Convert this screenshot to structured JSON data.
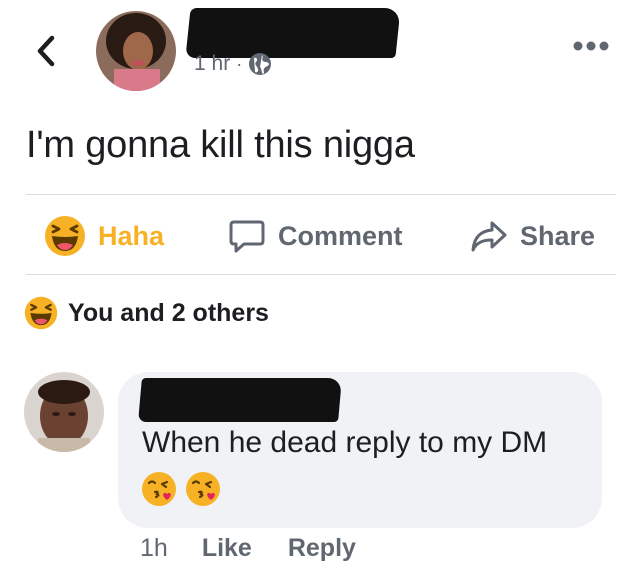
{
  "post": {
    "time": "1 hr",
    "separator": "·",
    "text": "I'm gonna kill this nigga"
  },
  "actions": {
    "haha_label": "Haha",
    "comment_label": "Comment",
    "share_label": "Share"
  },
  "reactions": {
    "summary": "You and 2 others"
  },
  "comment": {
    "text": "When he dead reply to my DM",
    "time": "1h",
    "like_label": "Like",
    "reply_label": "Reply"
  },
  "colors": {
    "haha_active": "#f7b125",
    "secondary_text": "#606770",
    "bubble_bg": "#f0f2f5",
    "divider": "#dadde1"
  },
  "icons": [
    "back-icon",
    "globe-icon",
    "more-icon",
    "haha-icon",
    "comment-icon",
    "share-icon",
    "kissing-heart-icon"
  ]
}
